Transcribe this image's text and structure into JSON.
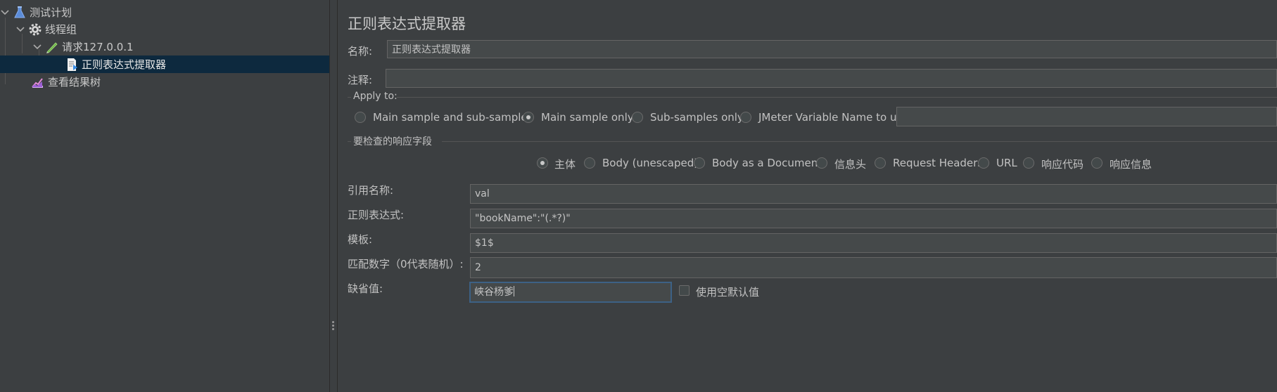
{
  "tree": {
    "items": [
      {
        "label": "测试计划",
        "icon": "flask-icon"
      },
      {
        "label": "线程组",
        "icon": "gear-icon"
      },
      {
        "label": "请求127.0.0.1",
        "icon": "pen-icon"
      },
      {
        "label": "正则表达式提取器",
        "icon": "document-arrow-icon"
      },
      {
        "label": "查看结果树",
        "icon": "chart-icon"
      }
    ]
  },
  "panel": {
    "title": "正则表达式提取器",
    "name_label": "名称:",
    "name_value": "正则表达式提取器",
    "comment_label": "注释:",
    "comment_value": "",
    "apply_to": {
      "label": "Apply to:",
      "options": [
        "Main sample and sub-samples",
        "Main sample only",
        "Sub-samples only",
        "JMeter Variable Name to use"
      ],
      "selected": "Main sample only",
      "variable_value": ""
    },
    "field_to_check": {
      "label": "要检查的响应字段",
      "options": [
        "主体",
        "Body (unescaped)",
        "Body as a Document",
        "信息头",
        "Request Headers",
        "URL",
        "响应代码",
        "响应信息"
      ],
      "selected": "主体"
    },
    "ref_name": {
      "label": "引用名称:",
      "value": "val"
    },
    "regex": {
      "label": "正则表达式:",
      "value": "\"bookName\":\"(.*?)\""
    },
    "template": {
      "label": "模板:",
      "value": "$1$"
    },
    "match_no": {
      "label": "匹配数字（0代表随机）:",
      "value": "2"
    },
    "default_value": {
      "label": "缺省值:",
      "value": "峡谷杨爹"
    },
    "use_empty_default": {
      "label": "使用空默认值",
      "checked": false
    }
  },
  "colors": {
    "background": "#3c3f41",
    "selection": "#0d293e",
    "focus_border": "#3d6185",
    "text": "#bbbbbb"
  }
}
